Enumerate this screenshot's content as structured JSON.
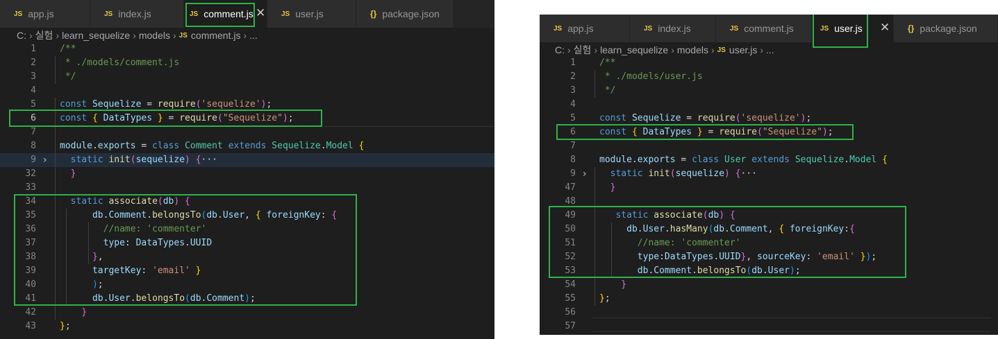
{
  "colors": {
    "keyword": "#569cd6",
    "type": "#4ec9b0",
    "variable": "#9cdcfe",
    "function": "#dcdcaa",
    "string": "#ce9178",
    "comment": "#6a9955",
    "text": "#d4d4d4",
    "brace1": "#ffd700",
    "brace2": "#da70d6",
    "brace3": "#179fff",
    "highlight": "#2fb24a"
  },
  "left": {
    "tabs": [
      {
        "icon": "JS",
        "label": "app.js",
        "active": false
      },
      {
        "icon": "JS",
        "label": "index.js",
        "active": false
      },
      {
        "icon": "JS",
        "label": "comment.js",
        "active": true,
        "close": "✕"
      },
      {
        "icon": "JS",
        "label": "user.js",
        "active": false
      },
      {
        "icon": "{}",
        "label": "package.json",
        "active": false
      }
    ],
    "breadcrumb": {
      "items": [
        "C:",
        "실험",
        "learn_sequelize",
        "models"
      ],
      "file_icon": "JS",
      "file": "comment.js",
      "tail": "..."
    },
    "lines": [
      {
        "n": "1",
        "tokens": [
          [
            "/**",
            "comment"
          ]
        ]
      },
      {
        "n": "2",
        "tokens": [
          [
            " * ./models/comment.js",
            "comment"
          ]
        ]
      },
      {
        "n": "3",
        "tokens": [
          [
            " */",
            "comment"
          ]
        ]
      },
      {
        "n": "4",
        "tokens": []
      },
      {
        "n": "5",
        "tokens": [
          [
            "const ",
            "keyword"
          ],
          [
            "Sequelize",
            "variable"
          ],
          [
            " = ",
            "text"
          ],
          [
            "require",
            "function"
          ],
          [
            "(",
            "brace2"
          ],
          [
            "'sequelize'",
            "string"
          ],
          [
            ")",
            "brace2"
          ],
          [
            ";",
            "text"
          ]
        ]
      },
      {
        "n": "6",
        "tokens": [
          [
            "const ",
            "keyword"
          ],
          [
            "{ ",
            "brace1"
          ],
          [
            "DataTypes",
            "variable"
          ],
          [
            " }",
            "brace1"
          ],
          [
            " = ",
            "text"
          ],
          [
            "require",
            "function"
          ],
          [
            "(",
            "brace2"
          ],
          [
            "\"Sequelize\"",
            "string"
          ],
          [
            ")",
            "brace2"
          ],
          [
            ";",
            "text"
          ]
        ],
        "current": true
      },
      {
        "n": "7",
        "tokens": []
      },
      {
        "n": "8",
        "tokens": [
          [
            "module",
            "variable"
          ],
          [
            ".",
            "text"
          ],
          [
            "exports",
            "variable"
          ],
          [
            " = ",
            "text"
          ],
          [
            "class ",
            "keyword"
          ],
          [
            "Comment ",
            "type"
          ],
          [
            "extends ",
            "keyword"
          ],
          [
            "Sequelize",
            "type"
          ],
          [
            ".",
            "text"
          ],
          [
            "Model ",
            "type"
          ],
          [
            "{",
            "brace1"
          ]
        ]
      },
      {
        "n": "9",
        "tokens": [
          [
            "  static ",
            "keyword"
          ],
          [
            "init",
            "function"
          ],
          [
            "(",
            "brace2"
          ],
          [
            "sequelize",
            "variable"
          ],
          [
            ") ",
            "brace2"
          ],
          [
            "{",
            "brace2"
          ],
          [
            "···",
            "text"
          ]
        ],
        "fold": "›",
        "folded": true
      },
      {
        "n": "32",
        "tokens": [
          [
            "  }",
            "brace2"
          ]
        ]
      },
      {
        "n": "33",
        "tokens": []
      },
      {
        "n": "34",
        "tokens": [
          [
            "  static ",
            "keyword"
          ],
          [
            "associate",
            "function"
          ],
          [
            "(",
            "brace2"
          ],
          [
            "db",
            "variable"
          ],
          [
            ") ",
            "brace2"
          ],
          [
            "{",
            "brace2"
          ]
        ]
      },
      {
        "n": "35",
        "tokens": [
          [
            "      db",
            "variable"
          ],
          [
            ".",
            "text"
          ],
          [
            "Comment",
            "variable"
          ],
          [
            ".",
            "text"
          ],
          [
            "belongsTo",
            "function"
          ],
          [
            "(",
            "brace3"
          ],
          [
            "db",
            "variable"
          ],
          [
            ".",
            "text"
          ],
          [
            "User",
            "variable"
          ],
          [
            ", ",
            "text"
          ],
          [
            "{ ",
            "brace1"
          ],
          [
            "foreignKey",
            "variable"
          ],
          [
            ": ",
            "text"
          ],
          [
            "{",
            "brace2"
          ]
        ]
      },
      {
        "n": "36",
        "tokens": [
          [
            "        //name: 'commenter'",
            "comment"
          ]
        ]
      },
      {
        "n": "37",
        "tokens": [
          [
            "        type",
            "variable"
          ],
          [
            ": ",
            "text"
          ],
          [
            "DataTypes",
            "variable"
          ],
          [
            ".",
            "text"
          ],
          [
            "UUID",
            "variable"
          ]
        ]
      },
      {
        "n": "38",
        "tokens": [
          [
            "      }",
            "brace2"
          ],
          [
            ",",
            "text"
          ]
        ]
      },
      {
        "n": "39",
        "tokens": [
          [
            "      targetKey",
            "variable"
          ],
          [
            ": ",
            "text"
          ],
          [
            "'email'",
            "string"
          ],
          [
            " }",
            "brace1"
          ]
        ]
      },
      {
        "n": "40",
        "tokens": [
          [
            "      )",
            "brace3"
          ],
          [
            ";",
            "text"
          ]
        ]
      },
      {
        "n": "41",
        "tokens": [
          [
            "      db",
            "variable"
          ],
          [
            ".",
            "text"
          ],
          [
            "User",
            "variable"
          ],
          [
            ".",
            "text"
          ],
          [
            "belongsTo",
            "function"
          ],
          [
            "(",
            "brace3"
          ],
          [
            "db",
            "variable"
          ],
          [
            ".",
            "text"
          ],
          [
            "Comment",
            "variable"
          ],
          [
            ")",
            "brace3"
          ],
          [
            ";",
            "text"
          ]
        ]
      },
      {
        "n": "42",
        "tokens": [
          [
            "    }",
            "brace2"
          ]
        ]
      },
      {
        "n": "43",
        "tokens": [
          [
            "}",
            "brace1"
          ],
          [
            ";",
            "text"
          ]
        ]
      }
    ]
  },
  "right": {
    "tabs": [
      {
        "icon": "JS",
        "label": "app.js",
        "active": false
      },
      {
        "icon": "JS",
        "label": "index.js",
        "active": false
      },
      {
        "icon": "JS",
        "label": "comment.js",
        "active": false
      },
      {
        "icon": "JS",
        "label": "user.js",
        "active": true,
        "close": "✕"
      },
      {
        "icon": "{}",
        "label": "package.json",
        "active": false
      }
    ],
    "breadcrumb": {
      "items": [
        "C:",
        "실험",
        "learn_sequelize",
        "models"
      ],
      "file_icon": "JS",
      "file": "user.js",
      "tail": "..."
    },
    "lines": [
      {
        "n": "1",
        "tokens": [
          [
            "/**",
            "comment"
          ]
        ]
      },
      {
        "n": "2",
        "tokens": [
          [
            " * ./models/user.js",
            "comment"
          ]
        ]
      },
      {
        "n": "3",
        "tokens": [
          [
            " */",
            "comment"
          ]
        ]
      },
      {
        "n": "4",
        "tokens": []
      },
      {
        "n": "5",
        "tokens": [
          [
            "const ",
            "keyword"
          ],
          [
            "Sequelize",
            "variable"
          ],
          [
            " = ",
            "text"
          ],
          [
            "require",
            "function"
          ],
          [
            "(",
            "brace2"
          ],
          [
            "'sequelize'",
            "string"
          ],
          [
            ")",
            "brace2"
          ],
          [
            ";",
            "text"
          ]
        ]
      },
      {
        "n": "6",
        "tokens": [
          [
            "const ",
            "keyword"
          ],
          [
            "{ ",
            "brace1"
          ],
          [
            "DataTypes",
            "variable"
          ],
          [
            " }",
            "brace1"
          ],
          [
            " = ",
            "text"
          ],
          [
            "require",
            "function"
          ],
          [
            "(",
            "brace2"
          ],
          [
            "\"Sequelize\"",
            "string"
          ],
          [
            ")",
            "brace2"
          ],
          [
            ";",
            "text"
          ]
        ]
      },
      {
        "n": "7",
        "tokens": []
      },
      {
        "n": "8",
        "tokens": [
          [
            "module",
            "variable"
          ],
          [
            ".",
            "text"
          ],
          [
            "exports",
            "variable"
          ],
          [
            " = ",
            "text"
          ],
          [
            "class ",
            "keyword"
          ],
          [
            "User ",
            "type"
          ],
          [
            "extends ",
            "keyword"
          ],
          [
            "Sequelize",
            "type"
          ],
          [
            ".",
            "text"
          ],
          [
            "Model ",
            "type"
          ],
          [
            "{",
            "brace1"
          ]
        ]
      },
      {
        "n": "9",
        "tokens": [
          [
            "  static ",
            "keyword"
          ],
          [
            "init",
            "function"
          ],
          [
            "(",
            "brace2"
          ],
          [
            "sequelize",
            "variable"
          ],
          [
            ") ",
            "brace2"
          ],
          [
            "{",
            "brace2"
          ],
          [
            "···",
            "text"
          ]
        ],
        "fold": "›"
      },
      {
        "n": "47",
        "tokens": [
          [
            "  }",
            "brace2"
          ]
        ]
      },
      {
        "n": "48",
        "tokens": []
      },
      {
        "n": "49",
        "tokens": [
          [
            "   static ",
            "keyword"
          ],
          [
            "associate",
            "function"
          ],
          [
            "(",
            "brace2"
          ],
          [
            "db",
            "variable"
          ],
          [
            ") ",
            "brace2"
          ],
          [
            "{",
            "brace2"
          ]
        ]
      },
      {
        "n": "50",
        "tokens": [
          [
            "     db",
            "variable"
          ],
          [
            ".",
            "text"
          ],
          [
            "User",
            "variable"
          ],
          [
            ".",
            "text"
          ],
          [
            "hasMany",
            "function"
          ],
          [
            "(",
            "brace3"
          ],
          [
            "db",
            "variable"
          ],
          [
            ".",
            "text"
          ],
          [
            "Comment",
            "variable"
          ],
          [
            ", ",
            "text"
          ],
          [
            "{ ",
            "brace1"
          ],
          [
            "foreignKey",
            "variable"
          ],
          [
            ":",
            "text"
          ],
          [
            "{",
            "brace2"
          ]
        ]
      },
      {
        "n": "51",
        "tokens": [
          [
            "       //name: 'commenter'",
            "comment"
          ]
        ]
      },
      {
        "n": "52",
        "tokens": [
          [
            "       type",
            "variable"
          ],
          [
            ":",
            "text"
          ],
          [
            "DataTypes",
            "variable"
          ],
          [
            ".",
            "text"
          ],
          [
            "UUID",
            "variable"
          ],
          [
            "}",
            "brace2"
          ],
          [
            ", ",
            "text"
          ],
          [
            "sourceKey",
            "variable"
          ],
          [
            ": ",
            "text"
          ],
          [
            "'email'",
            "string"
          ],
          [
            " }",
            "brace1"
          ],
          [
            ")",
            "brace3"
          ],
          [
            ";",
            "text"
          ]
        ]
      },
      {
        "n": "53",
        "tokens": [
          [
            "       db",
            "variable"
          ],
          [
            ".",
            "text"
          ],
          [
            "Comment",
            "variable"
          ],
          [
            ".",
            "text"
          ],
          [
            "belongsTo",
            "function"
          ],
          [
            "(",
            "brace3"
          ],
          [
            "db",
            "variable"
          ],
          [
            ".",
            "text"
          ],
          [
            "User",
            "variable"
          ],
          [
            ")",
            "brace3"
          ],
          [
            ";",
            "text"
          ]
        ]
      },
      {
        "n": "54",
        "tokens": [
          [
            "    }",
            "brace2"
          ]
        ]
      },
      {
        "n": "55",
        "tokens": [
          [
            "}",
            "brace1"
          ],
          [
            ";",
            "text"
          ]
        ]
      },
      {
        "n": "56",
        "tokens": []
      },
      {
        "n": "57",
        "tokens": []
      }
    ]
  }
}
